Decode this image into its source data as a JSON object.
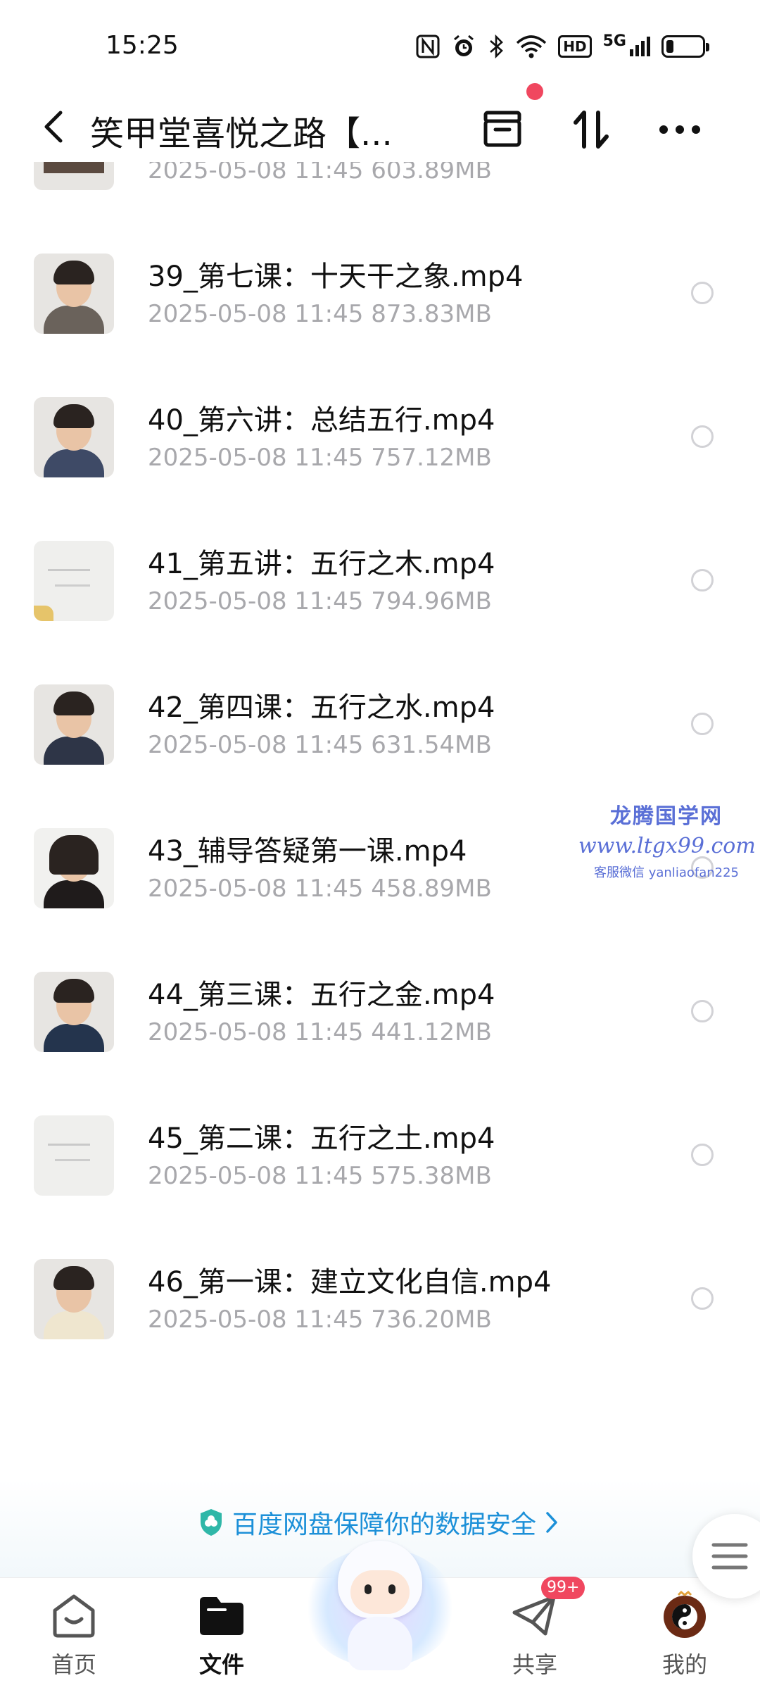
{
  "status_bar": {
    "time": "15:25",
    "network": "5G",
    "hd_label": "HD",
    "battery_level": 0.2,
    "icons": [
      "nfc-icon",
      "alarm-icon",
      "bluetooth-icon",
      "wifi-icon",
      "hd-icon",
      "signal-icon",
      "battery-icon"
    ]
  },
  "header": {
    "title": "笑甲堂喜悦之路【...",
    "icons": [
      "back-icon",
      "archive-icon",
      "sort-icon",
      "more-icon"
    ],
    "notification_dot_color": "#f0475f"
  },
  "files": [
    {
      "name": "",
      "date": "2025-05-08",
      "time": "11:45",
      "size": "603.89MB",
      "thumbnail": "person"
    },
    {
      "name": "39_第七课：十天干之象.mp4",
      "date": "2025-05-08",
      "time": "11:45",
      "size": "873.83MB",
      "thumbnail": "person"
    },
    {
      "name": "40_第六讲：总结五行.mp4",
      "date": "2025-05-08",
      "time": "11:45",
      "size": "757.12MB",
      "thumbnail": "person"
    },
    {
      "name": "41_第五讲：五行之木.mp4",
      "date": "2025-05-08",
      "time": "11:45",
      "size": "794.96MB",
      "thumbnail": "whiteboard"
    },
    {
      "name": "42_第四课：五行之水.mp4",
      "date": "2025-05-08",
      "time": "11:45",
      "size": "631.54MB",
      "thumbnail": "person"
    },
    {
      "name": "43_辅导答疑第一课.mp4",
      "date": "2025-05-08",
      "time": "11:45",
      "size": "458.89MB",
      "thumbnail": "person"
    },
    {
      "name": "44_第三课：五行之金.mp4",
      "date": "2025-05-08",
      "time": "11:45",
      "size": "441.12MB",
      "thumbnail": "person"
    },
    {
      "name": "45_第二课：五行之土.mp4",
      "date": "2025-05-08",
      "time": "11:45",
      "size": "575.38MB",
      "thumbnail": "whiteboard"
    },
    {
      "name": "46_第一课：建立文化自信.mp4",
      "date": "2025-05-08",
      "time": "11:45",
      "size": "736.20MB",
      "thumbnail": "person"
    }
  ],
  "watermark": {
    "title": "龙腾国学网",
    "url": "www.ltgx99.com",
    "contact": "客服微信 yanliaofan225"
  },
  "security_banner": {
    "text": "百度网盘保障你的数据安全",
    "color": "#1c90d8"
  },
  "bottom_nav": {
    "tabs": [
      {
        "label": "首页",
        "icon": "home-icon",
        "active": false
      },
      {
        "label": "文件",
        "icon": "folder-icon",
        "active": true
      },
      {
        "label": "共享",
        "icon": "share-icon",
        "active": false,
        "badge": "99+"
      },
      {
        "label": "我的",
        "icon": "avatar-icon",
        "active": false
      }
    ]
  },
  "colors": {
    "accent_red": "#f0475f",
    "meta_gray": "#a8a8ac",
    "watermark_blue": "#5a6fd6"
  }
}
